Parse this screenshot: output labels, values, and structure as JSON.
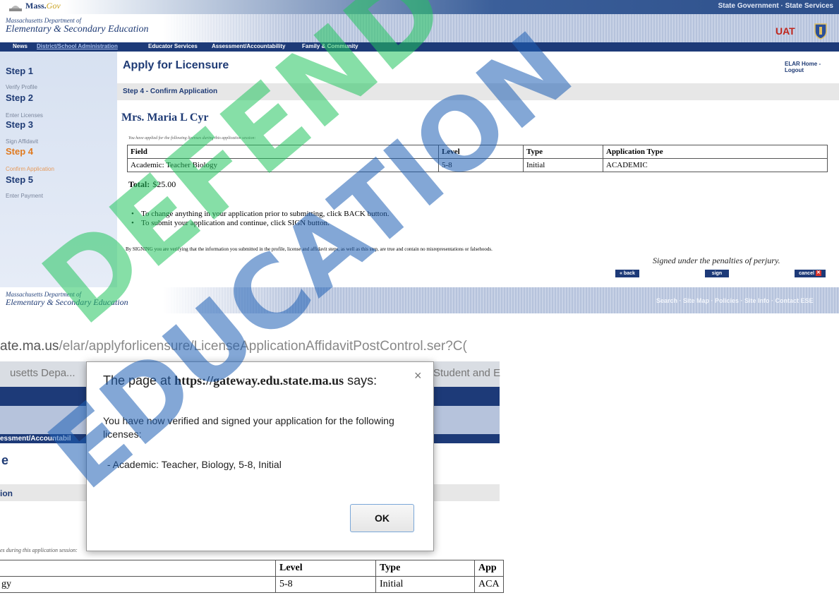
{
  "header": {
    "logo_text": "Mass.",
    "logo_gov": "Gov",
    "state_links": "State Government · State Services",
    "dept_small": "Massachusetts Department of",
    "dept_big": "Elementary & Secondary Education",
    "env_label": "UAT"
  },
  "nav": {
    "items": [
      "News",
      "District/School Administration",
      "Educator Services",
      "Assessment/Accountability",
      "Family & Community"
    ]
  },
  "sidebar": {
    "steps": [
      {
        "title": "Step 1",
        "sub": "Verify Profile"
      },
      {
        "title": "Step 2",
        "sub": "Enter Licenses"
      },
      {
        "title": "Step 3",
        "sub": "Sign Affidavit"
      },
      {
        "title": "Step 4",
        "sub": "Confirm Application"
      },
      {
        "title": "Step 5",
        "sub": "Enter Payment"
      }
    ]
  },
  "main": {
    "title": "Apply for Licensure",
    "top_links": "ELAR Home - Logout",
    "step_banner": "Step 4 - Confirm Application",
    "applicant": "Mrs. Maria L Cyr",
    "applied_note": "You have applied for the following licenses during this application session:",
    "table": {
      "headers": [
        "Field",
        "Level",
        "Type",
        "Application Type"
      ],
      "rows": [
        [
          "Academic: Teacher Biology",
          "5-8",
          "Initial",
          "ACADEMIC"
        ]
      ]
    },
    "total_label": "Total:",
    "total_value": "$25.00",
    "instructions": [
      "To change anything in your application prior to submitting, click BACK button.",
      "To submit your application and continue, click SIGN button."
    ],
    "disclaimer": "By SIGNING you are verifying that the information you submitted in the profile, license and affidavit steps, as well as this step, are true and contain no misrepresentations or falsehoods.",
    "penalties": "Signed under the penalties of perjury.",
    "back_label": "« back",
    "sign_label": "sign",
    "cancel_label": "cancel"
  },
  "footer": {
    "dept_small": "Massachusetts Department of",
    "dept_big": "Elementary & Secondary Education",
    "links": "Search · Site Map · Policies · Site Info · Contact ESE"
  },
  "browser": {
    "address_dark": "ate.ma.us",
    "address_gray": "/elar/applyforlicensure/LicenseApplicationAffidavitPostControl.ser?C(",
    "tab_left": "usetts Depa...",
    "tab_right": "Student and E",
    "nav_fragment": "essment/Accountabil",
    "title_fragment": "e",
    "banner_fragment": "ion",
    "note_fragment": "es during this application session:",
    "table_headers": [
      "",
      "Level",
      "Type",
      "App"
    ],
    "table_row": [
      "gy",
      "5-8",
      "Initial",
      "ACA"
    ]
  },
  "dialog": {
    "title_prefix": "The page at",
    "title_url": "https://gateway.edu.state.ma.us",
    "title_suffix": "says:",
    "close": "×",
    "message": "You have now verified and signed your application for the following licenses:",
    "item": " - Academic: Teacher, Biology, 5-8, Initial",
    "ok_label": "OK"
  },
  "watermark": {
    "line1": "DEFEND",
    "line2": "EDUCATION",
    "colors": [
      "#22c55e",
      "#1e5fb4"
    ]
  }
}
